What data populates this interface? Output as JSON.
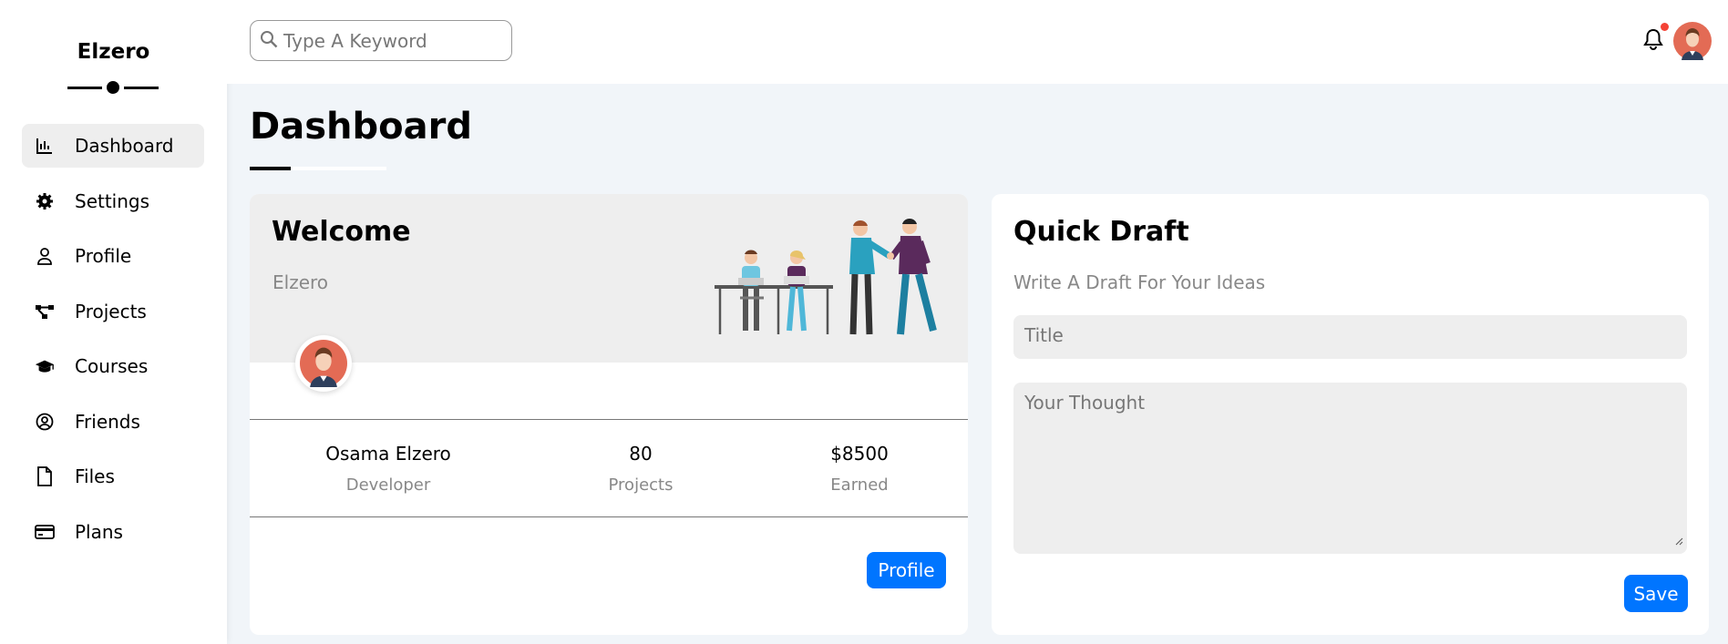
{
  "brand": "Elzero",
  "nav": [
    {
      "label": "Dashboard",
      "icon": "chart-icon",
      "active": true
    },
    {
      "label": "Settings",
      "icon": "gear-icon"
    },
    {
      "label": "Profile",
      "icon": "user-icon"
    },
    {
      "label": "Projects",
      "icon": "diagram-icon"
    },
    {
      "label": "Courses",
      "icon": "graduation-cap-icon"
    },
    {
      "label": "Friends",
      "icon": "user-circle-icon"
    },
    {
      "label": "Files",
      "icon": "file-icon"
    },
    {
      "label": "Plans",
      "icon": "credit-card-icon"
    }
  ],
  "search": {
    "placeholder": "Type A Keyword"
  },
  "page_title": "Dashboard",
  "welcome": {
    "title": "Welcome",
    "subtitle": "Elzero",
    "stats": [
      {
        "value": "Osama Elzero",
        "label": "Developer"
      },
      {
        "value": "80",
        "label": "Projects"
      },
      {
        "value": "$8500",
        "label": "Earned"
      }
    ],
    "button": "Profile"
  },
  "draft": {
    "title": "Quick Draft",
    "subtitle": "Write A Draft For Your Ideas",
    "title_placeholder": "Title",
    "thought_placeholder": "Your Thought",
    "button": "Save"
  },
  "colors": {
    "accent": "#0075ff",
    "notification": "#f44336",
    "background": "#f1f5f9"
  }
}
